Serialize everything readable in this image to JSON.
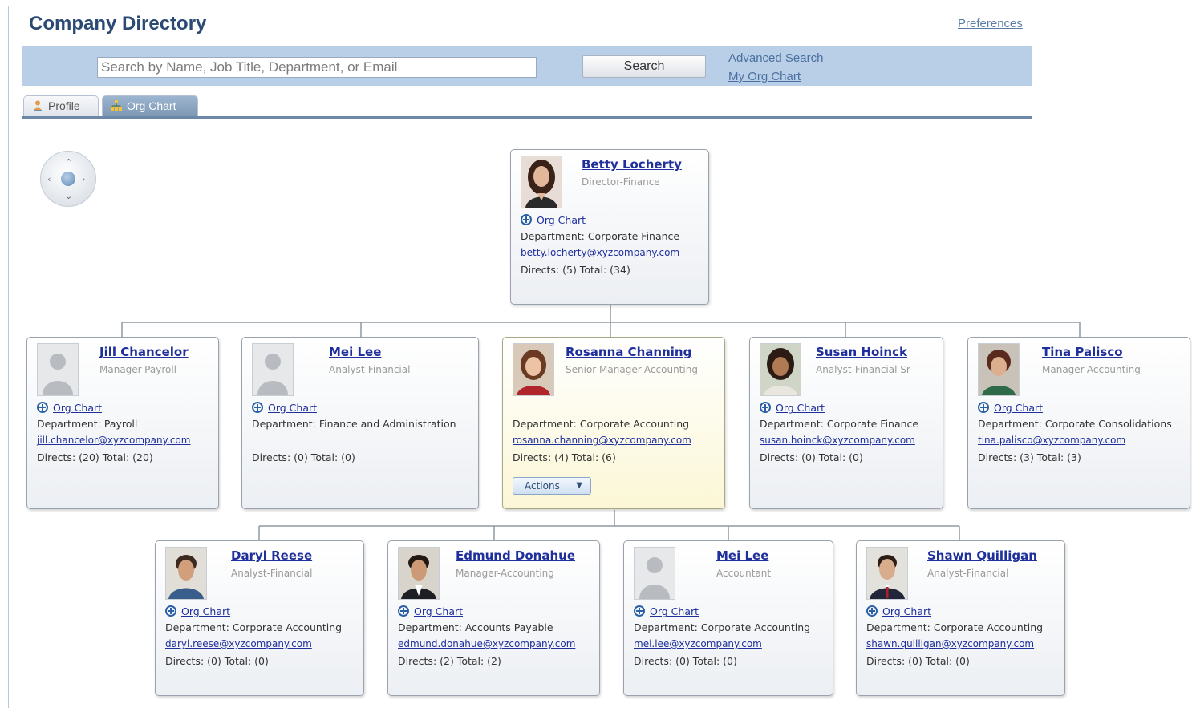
{
  "header": {
    "title": "Company Directory",
    "preferences_link": "Preferences"
  },
  "search": {
    "placeholder": "Search by Name, Job Title, Department, or Email",
    "value": "",
    "button_label": "Search",
    "advanced_search_link": "Advanced Search",
    "my_org_chart_link": "My Org Chart"
  },
  "tabs": [
    {
      "label": "Profile",
      "icon": "person-icon"
    },
    {
      "label": "Org Chart",
      "icon": "org-chart-icon",
      "active": true
    }
  ],
  "nav_control": {
    "icon": "pan-zoom-icon"
  },
  "org_chart_link_label": "Org Chart",
  "actions_label": "Actions",
  "manager": {
    "name": "Betty Locherty",
    "title": "Director-Finance",
    "department": "Department: Corporate Finance",
    "email": "betty.locherty@xyzcompany.com",
    "directs": "Directs: (5) Total: (34)"
  },
  "peers": [
    {
      "name": "Jill Chancelor",
      "title": "Manager-Payroll",
      "department": "Department: Payroll",
      "email": "jill.chancelor@xyzcompany.com",
      "directs": "Directs: (20) Total: (20)"
    },
    {
      "name": "Mei Lee",
      "title": "Analyst-Financial",
      "department": "Department: Finance and Administration",
      "email": "",
      "directs": "Directs: (0) Total: (0)"
    },
    {
      "name": "Rosanna Channing",
      "title": "Senior Manager-Accounting",
      "department": "Department: Corporate Accounting",
      "email": "rosanna.channing@xyzcompany.com",
      "directs": "Directs: (4) Total: (6)",
      "selected": true
    },
    {
      "name": "Susan Hoinck",
      "title": "Analyst-Financial Sr",
      "department": "Department: Corporate Finance",
      "email": "susan.hoinck@xyzcompany.com",
      "directs": "Directs: (0) Total: (0)"
    },
    {
      "name": "Tina Palisco",
      "title": "Manager-Accounting",
      "department": "Department: Corporate Consolidations",
      "email": "tina.palisco@xyzcompany.com",
      "directs": "Directs: (3) Total: (3)"
    }
  ],
  "reports": [
    {
      "name": "Daryl Reese",
      "title": "Analyst-Financial",
      "department": "Department: Corporate Accounting",
      "email": "daryl.reese@xyzcompany.com",
      "directs": "Directs: (0) Total: (0)"
    },
    {
      "name": "Edmund Donahue",
      "title": "Manager-Accounting",
      "department": "Department: Accounts Payable",
      "email": "edmund.donahue@xyzcompany.com",
      "directs": "Directs: (2) Total: (2)"
    },
    {
      "name": "Mei Lee",
      "title": "Accountant",
      "department": "Department: Corporate Accounting",
      "email": "mei.lee@xyzcompany.com",
      "directs": "Directs: (0) Total: (0)"
    },
    {
      "name": "Shawn Quilligan",
      "title": "Analyst-Financial",
      "department": "Department: Corporate Accounting",
      "email": "shawn.quilligan@xyzcompany.com",
      "directs": "Directs: (0) Total: (0)"
    }
  ]
}
